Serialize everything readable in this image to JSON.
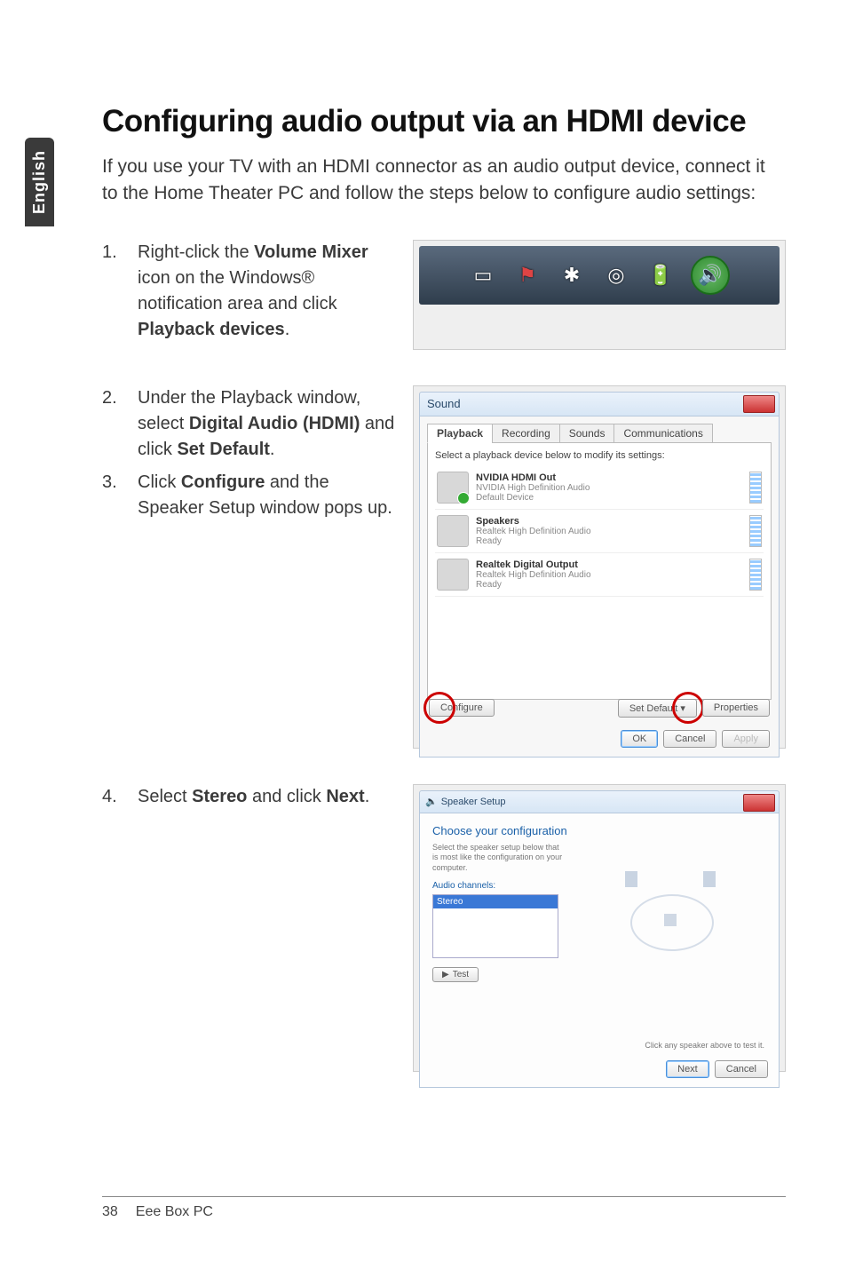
{
  "side_tab": "English",
  "heading": "Configuring audio output via an HDMI device",
  "intro": "If you use your TV with an HDMI connector as an audio output device, connect it to the Home Theater PC and follow the steps below to configure audio settings:",
  "step1": {
    "num": "1.",
    "pre": "Right-click the ",
    "b1": "Volume Mixer",
    "mid": " icon on the Windows® notification area and click ",
    "b2": "Playback devices",
    "post": "."
  },
  "step2": {
    "num": "2.",
    "pre": "Under the Playback window, select ",
    "b1": "Digital Audio (HDMI)",
    "mid": " and click ",
    "b2": "Set Default",
    "post": "."
  },
  "step3": {
    "num": "3.",
    "pre": "Click ",
    "b1": "Configure",
    "post": " and the Speaker Setup window pops up."
  },
  "step4": {
    "num": "4.",
    "pre": "Select ",
    "b1": "Stereo",
    "mid": " and click ",
    "b2": "Next",
    "post": "."
  },
  "sound_dialog": {
    "title": "Sound",
    "tabs": [
      "Playback",
      "Recording",
      "Sounds",
      "Communications"
    ],
    "instruction": "Select a playback device below to modify its settings:",
    "devices": [
      {
        "title": "NVIDIA HDMI Out",
        "sub1": "NVIDIA High Definition Audio",
        "sub2": "Default Device"
      },
      {
        "title": "Speakers",
        "sub1": "Realtek High Definition Audio",
        "sub2": "Ready"
      },
      {
        "title": "Realtek Digital Output",
        "sub1": "Realtek High Definition Audio",
        "sub2": "Ready"
      }
    ],
    "btn_configure": "Configure",
    "btn_set_default": "Set Default",
    "btn_properties": "Properties",
    "btn_ok": "OK",
    "btn_cancel": "Cancel",
    "btn_apply": "Apply"
  },
  "speaker_dialog": {
    "title": "Speaker Setup",
    "heading": "Choose your configuration",
    "sub": "Select the speaker setup below that is most like the configuration on your computer.",
    "list_label": "Audio channels:",
    "selected": "Stereo",
    "test": "Test",
    "note": "Click any speaker above to test it.",
    "btn_next": "Next",
    "btn_cancel": "Cancel"
  },
  "footer": {
    "page": "38",
    "product": "Eee Box PC"
  },
  "icons": {
    "net": "net-icon",
    "flag": "flag-icon",
    "bt": "bluetooth-icon",
    "eye": "eye-icon",
    "bat": "battery-icon",
    "vol": "volume-icon"
  }
}
